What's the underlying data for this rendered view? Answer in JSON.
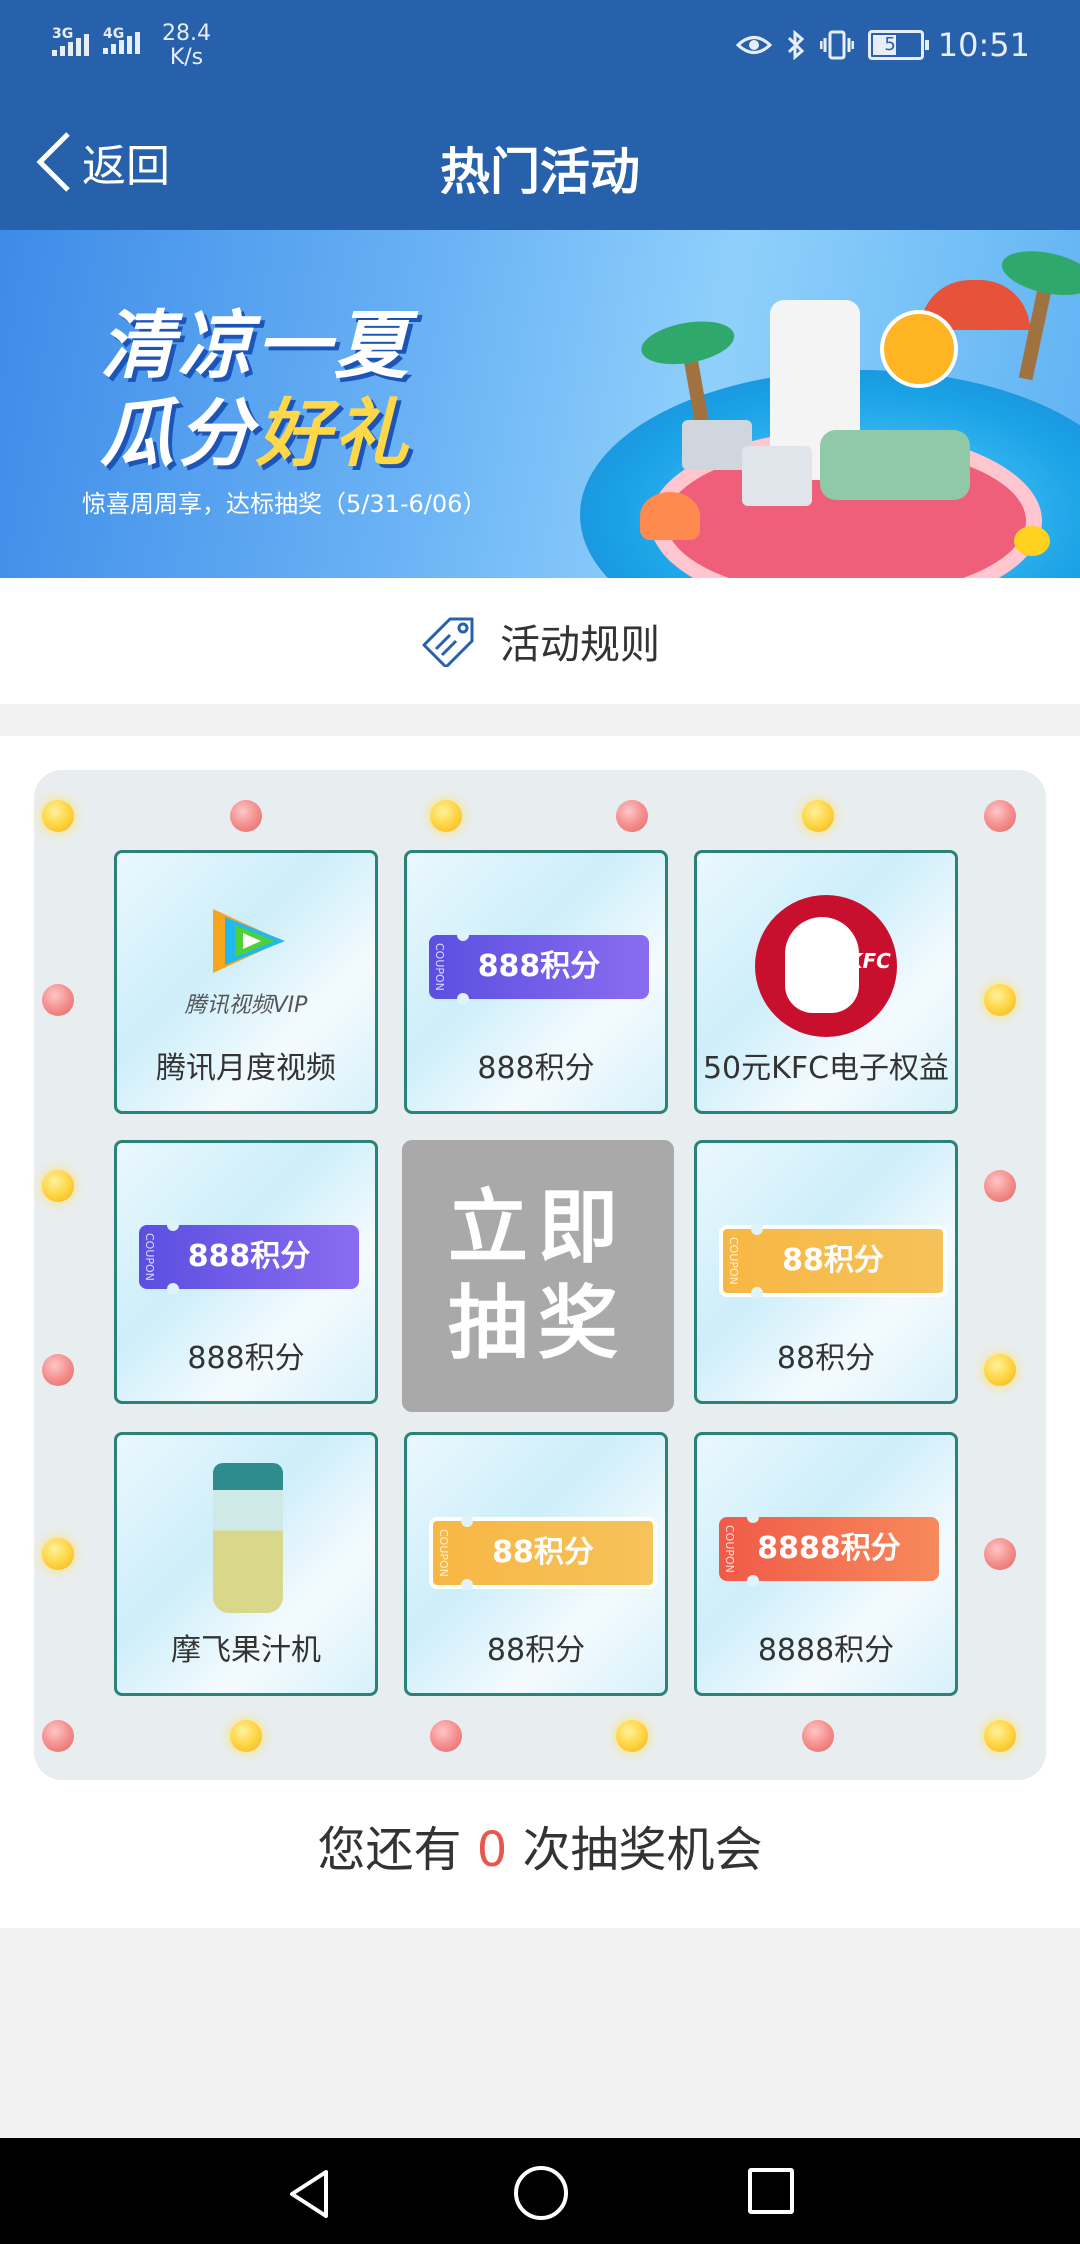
{
  "status_bar": {
    "signal1": "3G",
    "signal2": "4G",
    "speed_value": "28.4",
    "speed_unit": "K/s",
    "battery": "51",
    "time": "10:51"
  },
  "header": {
    "back_label": "返回",
    "title": "热门活动"
  },
  "banner": {
    "line1": "清凉一夏",
    "line2_a": "瓜分",
    "line2_b": "好礼",
    "subtitle": "惊喜周周享，达标抽奖（5/31-6/06）"
  },
  "rules": {
    "label": "活动规则"
  },
  "prizes": [
    {
      "label": "腾讯月度视频",
      "logo_text": "腾讯视频VIP"
    },
    {
      "label": "888积分",
      "ticket": "888积分"
    },
    {
      "label": "50元KFC电子权益",
      "logo_text": "KFC"
    },
    {
      "label": "888积分",
      "ticket": "888积分"
    },
    {
      "label": "88积分",
      "ticket": "88积分"
    },
    {
      "label": "摩飞果汁机"
    },
    {
      "label": "88积分",
      "ticket": "88积分"
    },
    {
      "label": "8888积分",
      "ticket": "8888积分"
    }
  ],
  "coupon_text": "COUPON",
  "draw_button": {
    "line1": "立即",
    "line2": "抽奖"
  },
  "chances": {
    "prefix": "您还有",
    "count": "0",
    "suffix": "次抽奖机会"
  },
  "colors": {
    "primary": "#2761ab",
    "accent_red": "#e8564c",
    "cell_border": "#2a8278"
  }
}
